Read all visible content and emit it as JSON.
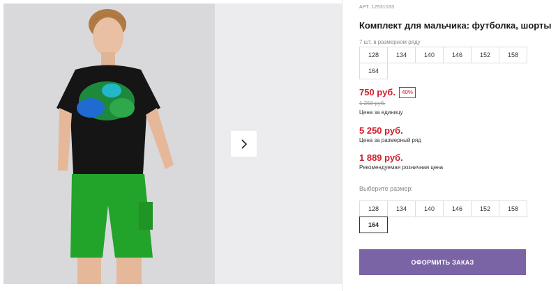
{
  "gallery": {
    "main_photo": "boy-in-tshirt-and-shorts-photo",
    "next_icon": "chevron-right-icon"
  },
  "product": {
    "sku": "АРТ. 12531033",
    "title": "Комплект для мальчика: футболка, шорты",
    "row_note": "7 шт. в размерном ряду",
    "row_sizes": [
      "128",
      "134",
      "140",
      "146",
      "152",
      "158",
      "164"
    ],
    "price": "750 руб.",
    "discount": "40%",
    "old_price": "1 250 руб.",
    "price_unit_note": "Цена за единицу",
    "row_price": "5 250 руб.",
    "row_price_note": "Цена за размерный ряд",
    "rrp_price": "1 889 руб.",
    "rrp_note": "Рекомендуемая розничная цена",
    "choose_label": "Выберите размер:",
    "sizes": [
      "128",
      "134",
      "140",
      "146",
      "152",
      "158",
      "164"
    ],
    "selected_size": "164",
    "order_button": "ОФОРМИТЬ ЗАКАЗ"
  },
  "colors": {
    "price_red": "#d0202e",
    "button_purple": "#7a64a6"
  }
}
